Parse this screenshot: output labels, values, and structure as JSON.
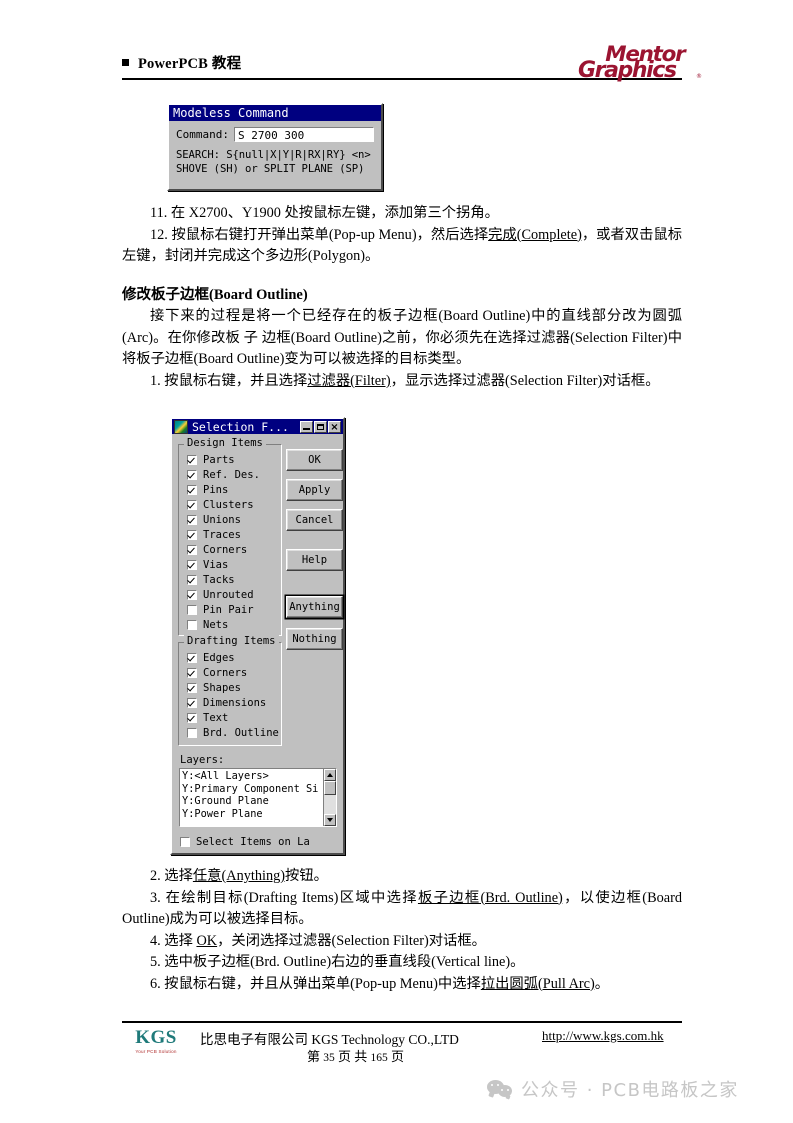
{
  "header": {
    "title": "PowerPCB 教程",
    "logo": {
      "line1": "Mentor",
      "line2": "Graphics",
      "tm": "®",
      "color": "#9b1431"
    }
  },
  "modeless_command": {
    "title": "Modeless Command",
    "icon": "window-icon",
    "buttons": {
      "minimize": "minimize-button",
      "maximize": "maximize-button",
      "close": "×"
    },
    "command_label": "Command:",
    "command_value": "S 2700 300",
    "hint_line1": "SEARCH: S{null|X|Y|R|RX|RY} <n>",
    "hint_line2": "SHOVE (SH) or SPLIT PLANE (SP)",
    "titlebar_color": "#000080"
  },
  "step11": "11. 在 X2700、Y1900 处按鼠标左键，添加第三个拐角。",
  "step12_a": "12. 按鼠标右键打开弹出菜单(Pop-up Menu)，然后选择",
  "step12_u": "完成(Complete)",
  "step12_b": "，或者双击鼠标左键，封闭并完成这个多边形(Polygon)。",
  "section": {
    "heading_cn": "修改板子边框",
    "heading_en": "(Board Outline)",
    "para": "接下来的过程是将一个已经存在的板子边框(Board  Outline)中的直线部分改为圆弧(Arc)。在你修改板 子 边框(Board  Outline)之前，你必须先在选择过滤器(Selection Filter)中将板子边框(Board Outline)变为可以被选择的目标类型。"
  },
  "step1_a": "1. 按鼠标右键，并且选择",
  "step1_u": "过滤器(Filter)",
  "step1_b": "，显示选择过滤器(Selection Filter)对话框。",
  "selection_filter": {
    "title": "Selection F...",
    "icon": "window-icon",
    "min_label": "minimize-button",
    "max_label": "maximize-button",
    "close_label": "×",
    "titlebar_color": "#000080",
    "design_items": {
      "group_label": "Design Items",
      "items": [
        {
          "label": "Parts",
          "checked": true
        },
        {
          "label": "Ref. Des.",
          "checked": true
        },
        {
          "label": "Pins",
          "checked": true
        },
        {
          "label": "Clusters",
          "checked": true
        },
        {
          "label": "Unions",
          "checked": true
        },
        {
          "label": "Traces",
          "checked": true
        },
        {
          "label": "Corners",
          "checked": true
        },
        {
          "label": "Vias",
          "checked": true
        },
        {
          "label": "Tacks",
          "checked": true
        },
        {
          "label": "Unrouted",
          "checked": true
        },
        {
          "label": "Pin Pair",
          "checked": false
        },
        {
          "label": "Nets",
          "checked": false
        }
      ]
    },
    "drafting_items": {
      "group_label": "Drafting Items",
      "items": [
        {
          "label": "Edges",
          "checked": true
        },
        {
          "label": "Corners",
          "checked": true
        },
        {
          "label": "Shapes",
          "checked": true
        },
        {
          "label": "Dimensions",
          "checked": true
        },
        {
          "label": "Text",
          "checked": true
        },
        {
          "label": "Brd. Outline",
          "checked": false
        }
      ]
    },
    "buttons": [
      {
        "label": "OK",
        "default": false
      },
      {
        "label": "Apply",
        "default": false
      },
      {
        "label": "Cancel",
        "default": false
      },
      {
        "label": "Help",
        "default": false
      },
      {
        "label": "Anything",
        "default": true
      },
      {
        "label": "Nothing",
        "default": false
      }
    ],
    "layers_label": "Layers:",
    "layers": [
      "Y:<All Layers>",
      "Y:Primary Component Si",
      "Y:Ground Plane",
      "Y:Power Plane"
    ],
    "bottom_checkbox": {
      "label": "Select Items on La",
      "checked": false
    }
  },
  "step2_a": "2. 选择",
  "step2_u": "任意(Anything)",
  "step2_b": "按钮。",
  "step3_a": "3. 在绘制目标(Drafting  Items)区域中选择",
  "step3_u": "板子边框(Brd.  Outline)",
  "step3_b": "，以使边框(Board Outline)成为可以被选择目标。",
  "step4_a": "4. 选择 ",
  "step4_u": "OK",
  "step4_b": "，关闭选择过滤器(Selection Filter)对话框。",
  "step5": "5. 选中板子边框(Brd. Outline)右边的垂直线段(Vertical line)。",
  "step6_a": "6. 按鼠标右键，并且从弹出菜单(Pop-up Menu)中选择",
  "step6_u": "拉出圆弧(Pull Arc)",
  "step6_b": "。",
  "footer": {
    "logo_main": "KGS",
    "logo_sub": "Your PCB Solution",
    "company": "比思电子有限公司 KGS Technology CO.,LTD",
    "page_prefix": "第",
    "page_current": "35",
    "page_middle": "页 共",
    "page_total": "165",
    "page_suffix": "页",
    "url": "http://www.kgs.com.hk"
  },
  "watermark": {
    "icon": "wechat-icon",
    "text": "公众号 · PCB电路板之家"
  }
}
